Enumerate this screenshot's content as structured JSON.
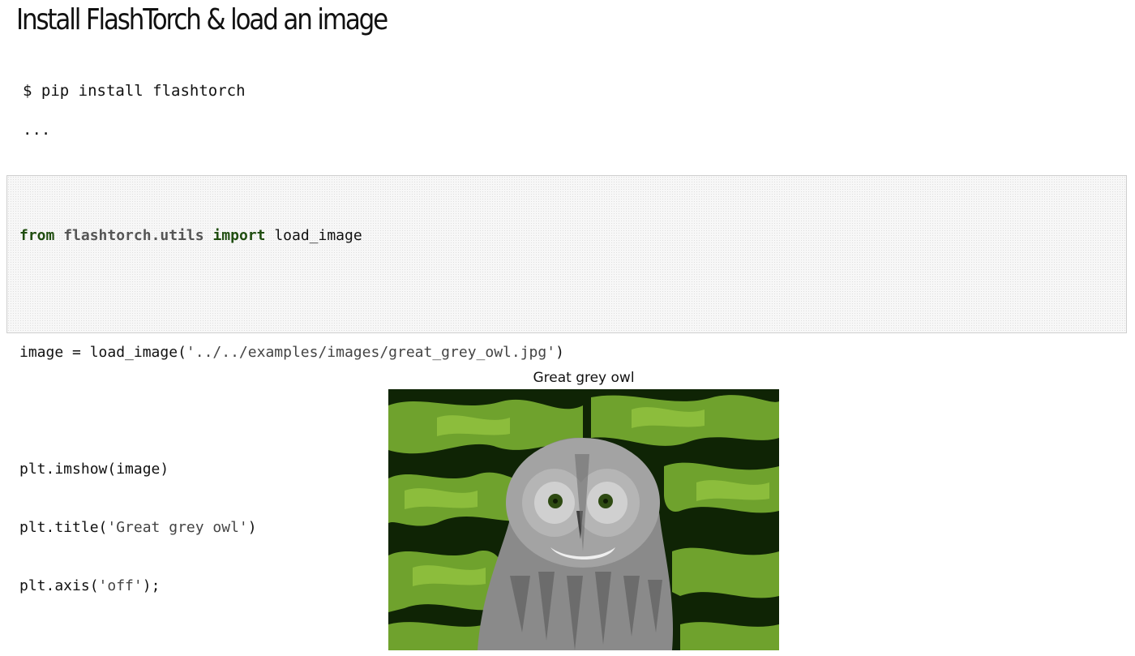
{
  "notebook": {
    "heading": "Install FlashTorch & load an image",
    "markdown": {
      "command": "$ pip install flashtorch",
      "ellipsis": "..."
    },
    "code": {
      "line1": {
        "kw_from": "from",
        "module": "flashtorch.utils",
        "kw_import": "import",
        "name": "load_image"
      },
      "line2": {
        "prefix": "image = load_image(",
        "arg": "'../../examples/images/great_grey_owl.jpg'",
        "suffix": ")"
      },
      "line3": {
        "text": "plt.imshow(image)"
      },
      "line4": {
        "prefix": "plt.title(",
        "arg": "'Great grey owl'",
        "suffix": ")"
      },
      "line5": {
        "prefix": "plt.axis(",
        "arg": "'off'",
        "suffix": ");"
      }
    },
    "output": {
      "figure_title": "Great grey owl",
      "colors": {
        "background_dark": "#0f2405",
        "foliage": "#6fa22d",
        "foliage_light": "#8cbd3c",
        "owl_grey": "#9a9a9a"
      }
    }
  }
}
